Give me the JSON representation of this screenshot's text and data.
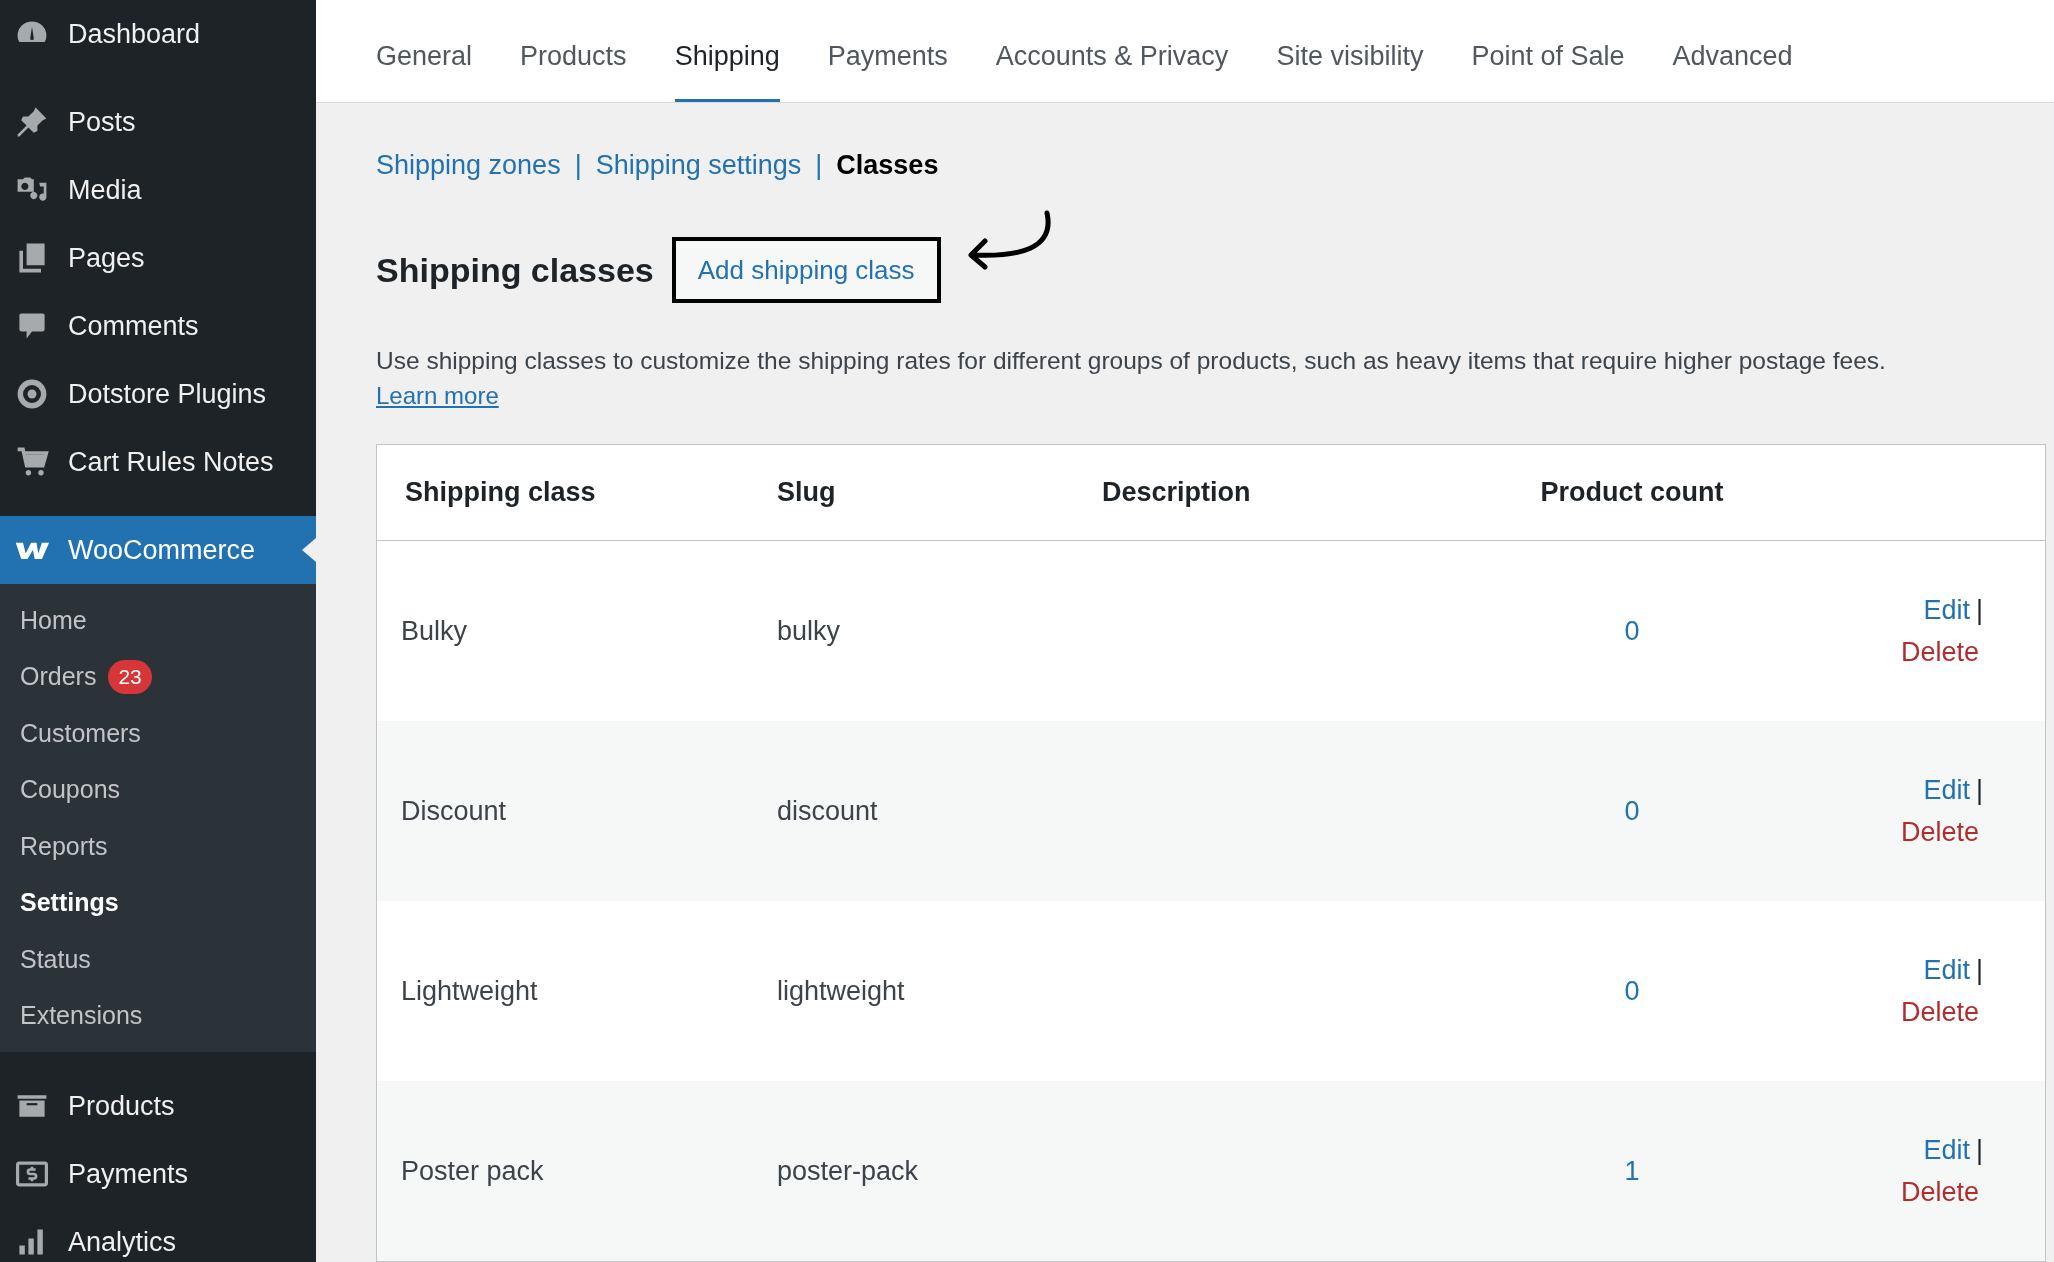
{
  "sidebar": {
    "items": [
      {
        "label": "Dashboard",
        "selected": false
      },
      {
        "label": "Posts",
        "selected": false
      },
      {
        "label": "Media",
        "selected": false
      },
      {
        "label": "Pages",
        "selected": false
      },
      {
        "label": "Comments",
        "selected": false
      },
      {
        "label": "Dotstore Plugins",
        "selected": false
      },
      {
        "label": "Cart Rules Notes",
        "selected": false
      },
      {
        "label": "WooCommerce",
        "selected": true,
        "submenu": [
          {
            "label": "Home",
            "selected": false
          },
          {
            "label": "Orders",
            "badge": "23",
            "selected": false
          },
          {
            "label": "Customers",
            "selected": false
          },
          {
            "label": "Coupons",
            "selected": false
          },
          {
            "label": "Reports",
            "selected": false
          },
          {
            "label": "Settings",
            "selected": true
          },
          {
            "label": "Status",
            "selected": false
          },
          {
            "label": "Extensions",
            "selected": false
          }
        ]
      },
      {
        "label": "Products",
        "selected": false
      },
      {
        "label": "Payments",
        "selected": false
      },
      {
        "label": "Analytics",
        "selected": false
      }
    ]
  },
  "tabs": [
    {
      "label": "General",
      "selected": false
    },
    {
      "label": "Products",
      "selected": false
    },
    {
      "label": "Shipping",
      "selected": true
    },
    {
      "label": "Payments",
      "selected": false
    },
    {
      "label": "Accounts & Privacy",
      "selected": false
    },
    {
      "label": "Site visibility",
      "selected": false
    },
    {
      "label": "Point of Sale",
      "selected": false
    },
    {
      "label": "Advanced",
      "selected": false
    }
  ],
  "subnav": [
    {
      "label": "Shipping zones",
      "selected": false
    },
    {
      "separator": "|",
      "label": "Shipping settings",
      "selected": false
    },
    {
      "separator": "|",
      "label": "Classes",
      "selected": true
    }
  ],
  "heading": "Shipping classes",
  "add_button": "Add shipping class",
  "description": "Use shipping classes to customize the shipping rates for different groups of products, such as heavy items that require higher postage fees.",
  "learn_more": "Learn more",
  "table": {
    "columns": [
      "Shipping class",
      "Slug",
      "Description",
      "Product count"
    ],
    "rows": [
      {
        "name": "Bulky",
        "slug": "bulky",
        "count": "0",
        "edit": "Edit",
        "separator": "|",
        "delete": "Delete"
      },
      {
        "name": "Discount",
        "slug": "discount",
        "count": "0",
        "edit": "Edit",
        "separator": "|",
        "delete": "Delete"
      },
      {
        "name": "Lightweight",
        "slug": "lightweight",
        "count": "0",
        "edit": "Edit",
        "separator": "|",
        "delete": "Delete"
      },
      {
        "name": "Poster pack",
        "slug": "poster-pack",
        "count": "1",
        "edit": "Edit",
        "separator": "|",
        "delete": "Delete"
      }
    ]
  }
}
